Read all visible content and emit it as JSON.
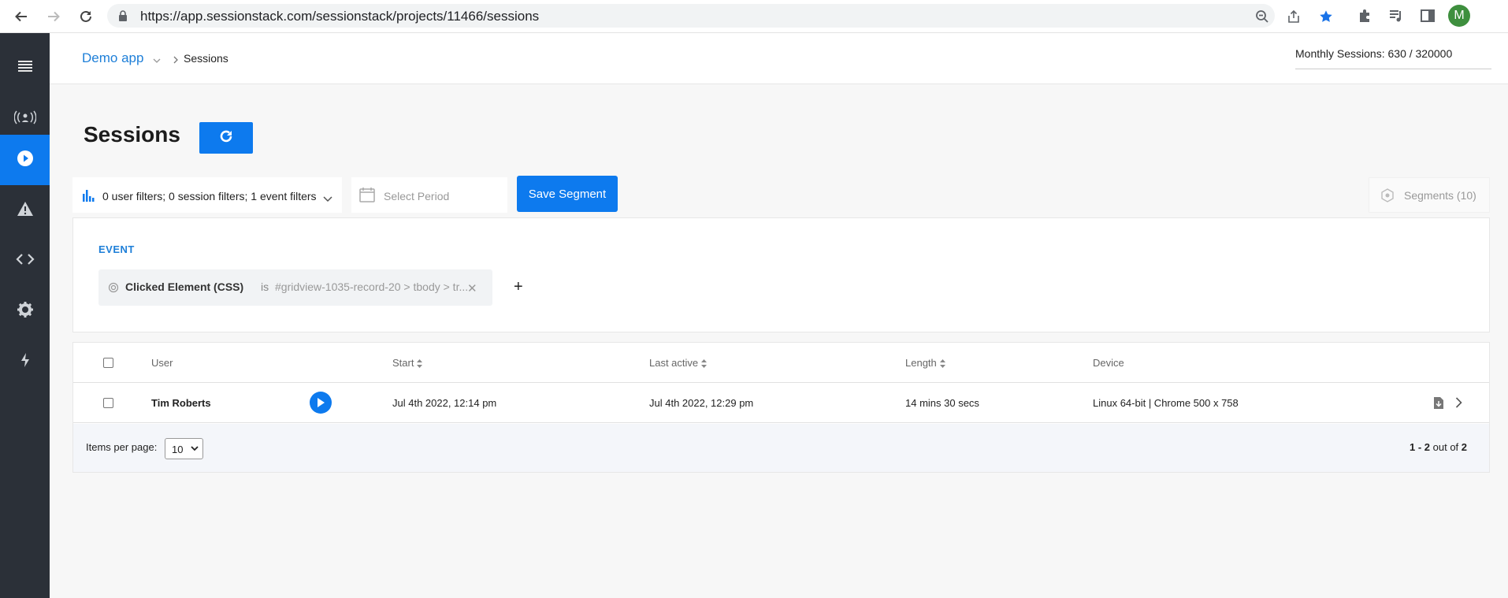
{
  "browser": {
    "url": "https://app.sessionstack.com/sessionstack/projects/11466/sessions",
    "avatar_letter": "M"
  },
  "sidebar": {
    "items": [
      {
        "name": "menu",
        "icon": "menu-icon"
      },
      {
        "name": "live",
        "icon": "broadcast-icon"
      },
      {
        "name": "sessions",
        "icon": "play-circle-icon",
        "active": true
      },
      {
        "name": "alerts",
        "icon": "warning-icon"
      },
      {
        "name": "integrations",
        "icon": "code-icon"
      },
      {
        "name": "settings",
        "icon": "gear-icon"
      },
      {
        "name": "quick",
        "icon": "bolt-icon"
      }
    ]
  },
  "topbar": {
    "app_name": "Demo app",
    "breadcrumb": "Sessions",
    "monthly_sessions": "Monthly Sessions: 630 / 320000"
  },
  "page": {
    "title": "Sessions"
  },
  "filters": {
    "summary": "0 user filters; 0 session filters; 1 event filters",
    "period_placeholder": "Select Period",
    "save_segment": "Save Segment",
    "segments": "Segments (10)"
  },
  "event": {
    "heading": "EVENT",
    "condition_name": "Clicked Element (CSS)",
    "operator": "is",
    "value": "#gridview-1035-record-20 > tbody > tr...",
    "add_label": "+"
  },
  "table": {
    "columns": {
      "user": "User",
      "start": "Start",
      "last_active": "Last active",
      "length": "Length",
      "device": "Device"
    },
    "rows": [
      {
        "user": "Tim Roberts",
        "start": "Jul 4th 2022, 12:14 pm",
        "last_active": "Jul 4th 2022, 12:29 pm",
        "length": "14 mins 30 secs",
        "device": "Linux 64-bit | Chrome 500 x 758"
      }
    ],
    "items_per_page_label": "Items per page:",
    "items_per_page_value": "10",
    "pager_range": "1 - 2",
    "pager_of": "out of",
    "pager_total": "2"
  },
  "colors": {
    "accent": "#0d7aee",
    "sidebar": "#2b3038",
    "link": "#1e7fd8"
  }
}
